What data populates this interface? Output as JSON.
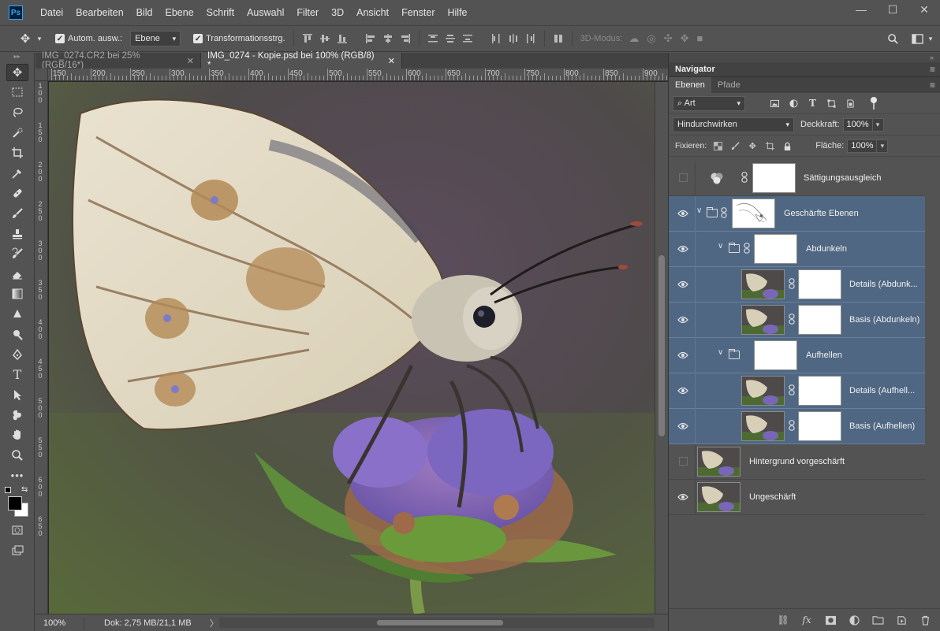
{
  "menubar": {
    "logo": "Ps",
    "items": [
      "Datei",
      "Bearbeiten",
      "Bild",
      "Ebene",
      "Schrift",
      "Auswahl",
      "Filter",
      "3D",
      "Ansicht",
      "Fenster",
      "Hilfe"
    ],
    "window_controls": {
      "minimize": "—",
      "maximize": "☐",
      "close": "✕"
    }
  },
  "options": {
    "auto_select_label": "Autom. ausw.:",
    "auto_select_value": "Ebene",
    "transform_label": "Transformationsstrg.",
    "mode_3d_label": "3D-Modus:"
  },
  "tabs": [
    {
      "title": "IMG_0274.CR2 bei 25% (RGB/16*)",
      "active": false
    },
    {
      "title": "IMG_0274 - Kopie.psd bei 100% (RGB/8) *",
      "active": true
    }
  ],
  "ruler": {
    "h_labels": [
      "150",
      "200",
      "250",
      "300",
      "350",
      "400",
      "450",
      "500",
      "550",
      "600",
      "650",
      "700",
      "750",
      "800",
      "850",
      "900"
    ],
    "v_labels": [
      "1",
      "0",
      "0",
      "1",
      "5",
      "0",
      "2",
      "0",
      "0",
      "2",
      "5",
      "0",
      "3",
      "0",
      "0",
      "3",
      "5",
      "0",
      "4",
      "0",
      "0",
      "4",
      "5",
      "0",
      "5",
      "0",
      "0",
      "5",
      "5",
      "0",
      "6",
      "0",
      "0",
      "6",
      "5",
      "0"
    ]
  },
  "status": {
    "zoom": "100%",
    "doc_info": "Dok: 2,75 MB/21,1 MB",
    "arrow": "〉"
  },
  "panels": {
    "navigator_title": "Navigator",
    "collapse": "»",
    "layer_tabs": [
      "Ebenen",
      "Pfade"
    ],
    "filter_value": "Art",
    "blend_mode": "Hindurchwirken",
    "opacity_label": "Deckkraft:",
    "opacity_value": "100%",
    "lock_label": "Fixieren:",
    "fill_label": "Fläche:",
    "fill_value": "100%"
  },
  "layers": [
    {
      "name": "Sättigungsausgleich",
      "visible": false,
      "kind": "adjustment",
      "selected": false
    },
    {
      "name": "Geschärfte Ebenen",
      "visible": true,
      "kind": "group-mask",
      "selected": true
    },
    {
      "name": "Abdunkeln",
      "visible": true,
      "kind": "group",
      "selected": true
    },
    {
      "name": "Details (Abdunk...",
      "visible": true,
      "kind": "pixel",
      "selected": true
    },
    {
      "name": "Basis (Abdunkeln)",
      "visible": true,
      "kind": "pixel",
      "selected": true
    },
    {
      "name": "Aufhellen",
      "visible": true,
      "kind": "group",
      "selected": true
    },
    {
      "name": "Details (Aufhell...",
      "visible": true,
      "kind": "pixel",
      "selected": true
    },
    {
      "name": "Basis (Aufhellen)",
      "visible": true,
      "kind": "pixel",
      "selected": true
    },
    {
      "name": "Hintergrund vorgeschärft",
      "visible": false,
      "kind": "plain",
      "selected": false
    },
    {
      "name": "Ungeschärft",
      "visible": true,
      "kind": "plain",
      "selected": false
    }
  ],
  "bottom_icons": [
    "link-icon",
    "fx-icon",
    "mask-icon",
    "adjustment-icon",
    "new-group-icon",
    "new-layer-icon",
    "trash-icon"
  ],
  "colors": {
    "accent": "#31a8ff",
    "selected_layer": "#4f6783",
    "panel_bg": "#535353",
    "canvas_bg": "#282828"
  }
}
